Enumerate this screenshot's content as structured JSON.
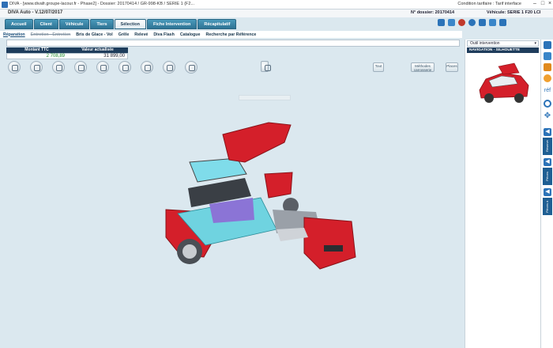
{
  "window": {
    "title": "DIVA - [www.divafr.groupe-lacour.fr - Phase2] - Dossier: 20170414 / GR-998-KB / SERIE 1 (F2...",
    "condition": "Condition tarifaire : Tarif interface"
  },
  "appbar": {
    "version": "DIVA Auto - V.12/07/2017",
    "dossier": "N° dossier: 20170414",
    "vehicule": "Véhicule: SERIE 1 F20 LCI"
  },
  "tabs": [
    {
      "label": "Accueil"
    },
    {
      "label": "Client"
    },
    {
      "label": "Véhicule"
    },
    {
      "label": "Tiers"
    },
    {
      "label": "Sélection"
    },
    {
      "label": "Fiche Intervention"
    },
    {
      "label": "Récapitulatif"
    }
  ],
  "subnav": [
    {
      "label": "Réparation"
    },
    {
      "label": "Entretien - Entretien"
    },
    {
      "label": "Bris de Glace - Vol"
    },
    {
      "label": "Grêle"
    },
    {
      "label": "Relevé"
    },
    {
      "label": "Diva Flash"
    },
    {
      "label": "Catalogue"
    },
    {
      "label": "Recherche par Référence"
    }
  ],
  "totals": {
    "header_ttc": "Montant TTC",
    "header_value": "Valeur actualisée",
    "value_ttc": "2 708,89",
    "value_actual": "31 899,00"
  },
  "buttons": {
    "view_mode": "Méthodes carrosserie",
    "places": "Places",
    "small_a": "Tout"
  },
  "rightpanel": {
    "dropdown": "Outil intervention",
    "nav_label": "NAVIGATION - SILHOUETTE"
  },
  "sidebar": {
    "labels": [
      "Réserve Nomenclat.",
      "Pièces remplacées",
      "Pièces à Déduire"
    ],
    "ref_label": "réf"
  },
  "colors": {
    "tab_blue": "#2e7394",
    "header_navy": "#1f3d5c",
    "car_red": "#d41f2a",
    "panel_cyan": "#6fd3e0",
    "panel_purple": "#8b74d6"
  }
}
